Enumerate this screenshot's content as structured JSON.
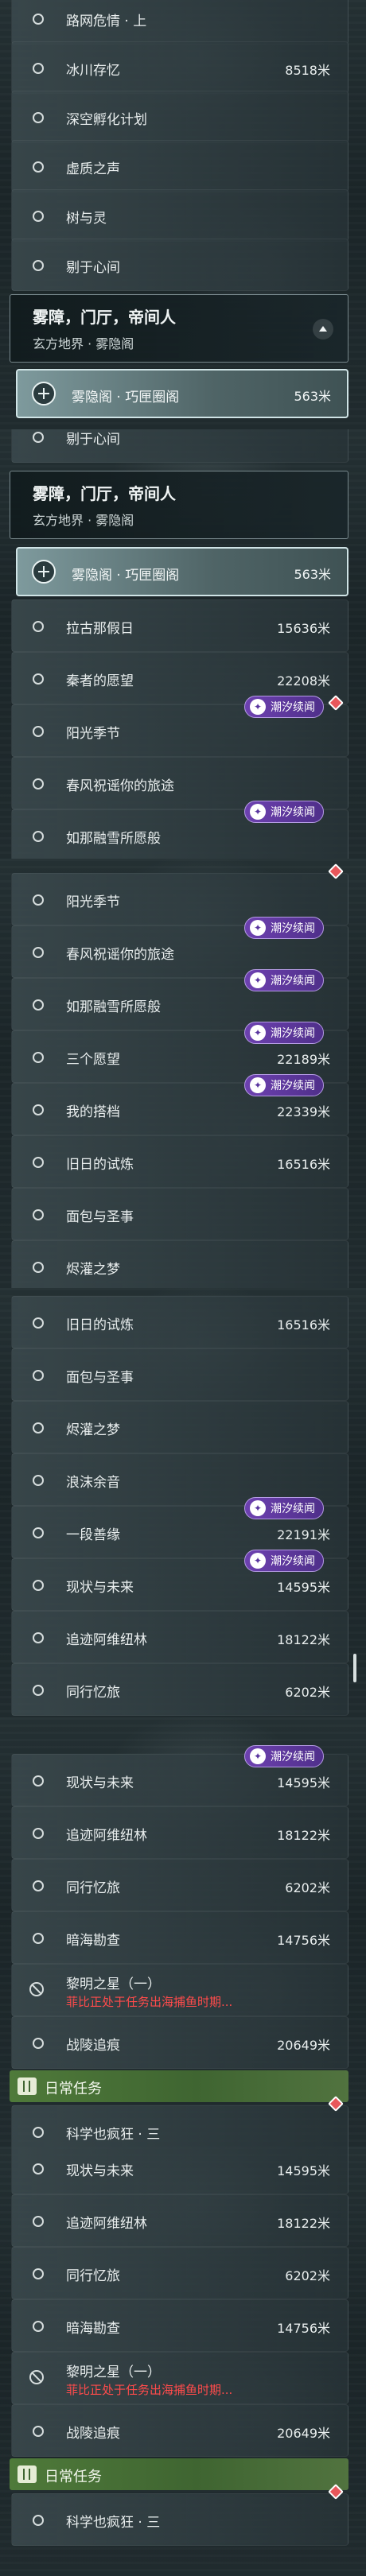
{
  "tag_label": "潮汐续闻",
  "daily_header": "日常任务",
  "group": {
    "title": "雾障，门厅，帝间人",
    "subtitle": "玄方地界 · 雾隐阁"
  },
  "selected": {
    "name": "雾隐阁 · 巧匣圈阁",
    "dist": "563米"
  },
  "items": {
    "a": {
      "name": "路网危情 · 上"
    },
    "b": {
      "name": "冰川存忆",
      "dist": "8518米"
    },
    "c": {
      "name": "深空孵化计划"
    },
    "d": {
      "name": "虚质之声"
    },
    "e": {
      "name": "树与灵"
    },
    "f": {
      "name": "剔于心间"
    },
    "g": {
      "name": "拉古那假日",
      "dist": "15636米"
    },
    "h": {
      "name": "秦者的愿望",
      "dist": "22208米"
    },
    "i": {
      "name": "阳光季节"
    },
    "j": {
      "name": "春风祝谣你的旅途"
    },
    "k": {
      "name": "如那融雪所愿般"
    },
    "l": {
      "name": "三个愿望",
      "dist": "22189米"
    },
    "m": {
      "name": "我的搭档",
      "dist": "22339米"
    },
    "n": {
      "name": "旧日的试炼",
      "dist": "16516米"
    },
    "o": {
      "name": "面包与圣事"
    },
    "p": {
      "name": "烬灌之梦"
    },
    "q": {
      "name": "浪沫余音"
    },
    "r": {
      "name": "一段善缘",
      "dist": "22191米"
    },
    "s": {
      "name": "现状与未来",
      "dist": "14595米"
    },
    "t": {
      "name": "追迹阿维纽林",
      "dist": "18122米"
    },
    "u": {
      "name": "同行忆旅",
      "dist": "6202米"
    },
    "v": {
      "name": "暗海勘查",
      "dist": "14756米"
    },
    "w": {
      "name": "黎明之星（一）",
      "note": "菲比正处于任务出海捕鱼时期..."
    },
    "x": {
      "name": "战陵追痕",
      "dist": "20649米"
    },
    "y": {
      "name": "科学也疯狂 · 三"
    }
  },
  "colors": {
    "tag_purple": "#6d41b0",
    "alert_red": "#ff4b4b",
    "daily_green": "#4f7a3a",
    "diamond_red": "#e8575b"
  }
}
